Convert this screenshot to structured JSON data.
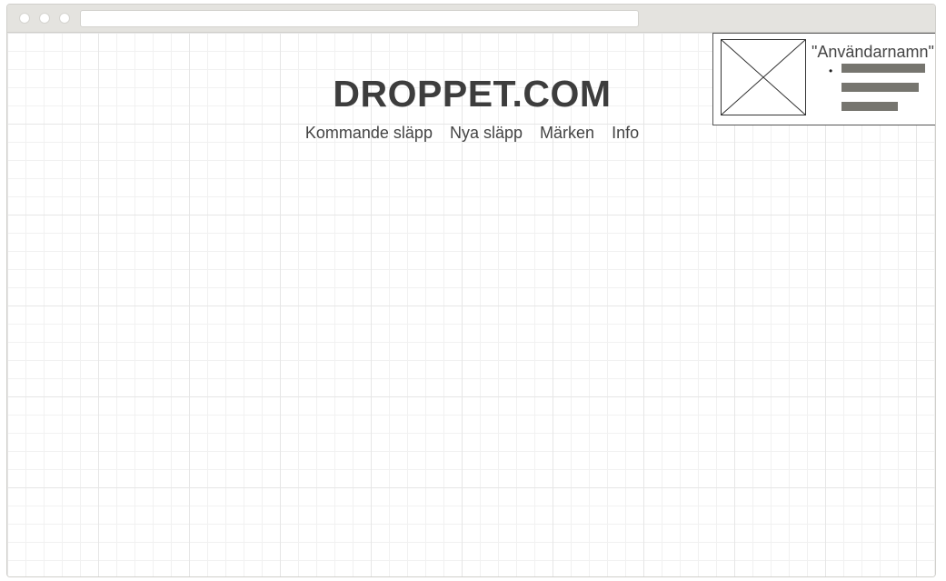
{
  "site": {
    "title": "DROPPET.COM"
  },
  "nav": {
    "items": [
      {
        "label": "Kommande släpp"
      },
      {
        "label": "Nya släpp"
      },
      {
        "label": "Märken"
      },
      {
        "label": "Info"
      }
    ]
  },
  "user_panel": {
    "username": "\"Användarnamn\"",
    "avatar_icon": "image-placeholder-icon"
  },
  "colors": {
    "text": "#3d3d3d",
    "chrome": "#e4e3df",
    "placeholder_bar": "#76756f"
  }
}
